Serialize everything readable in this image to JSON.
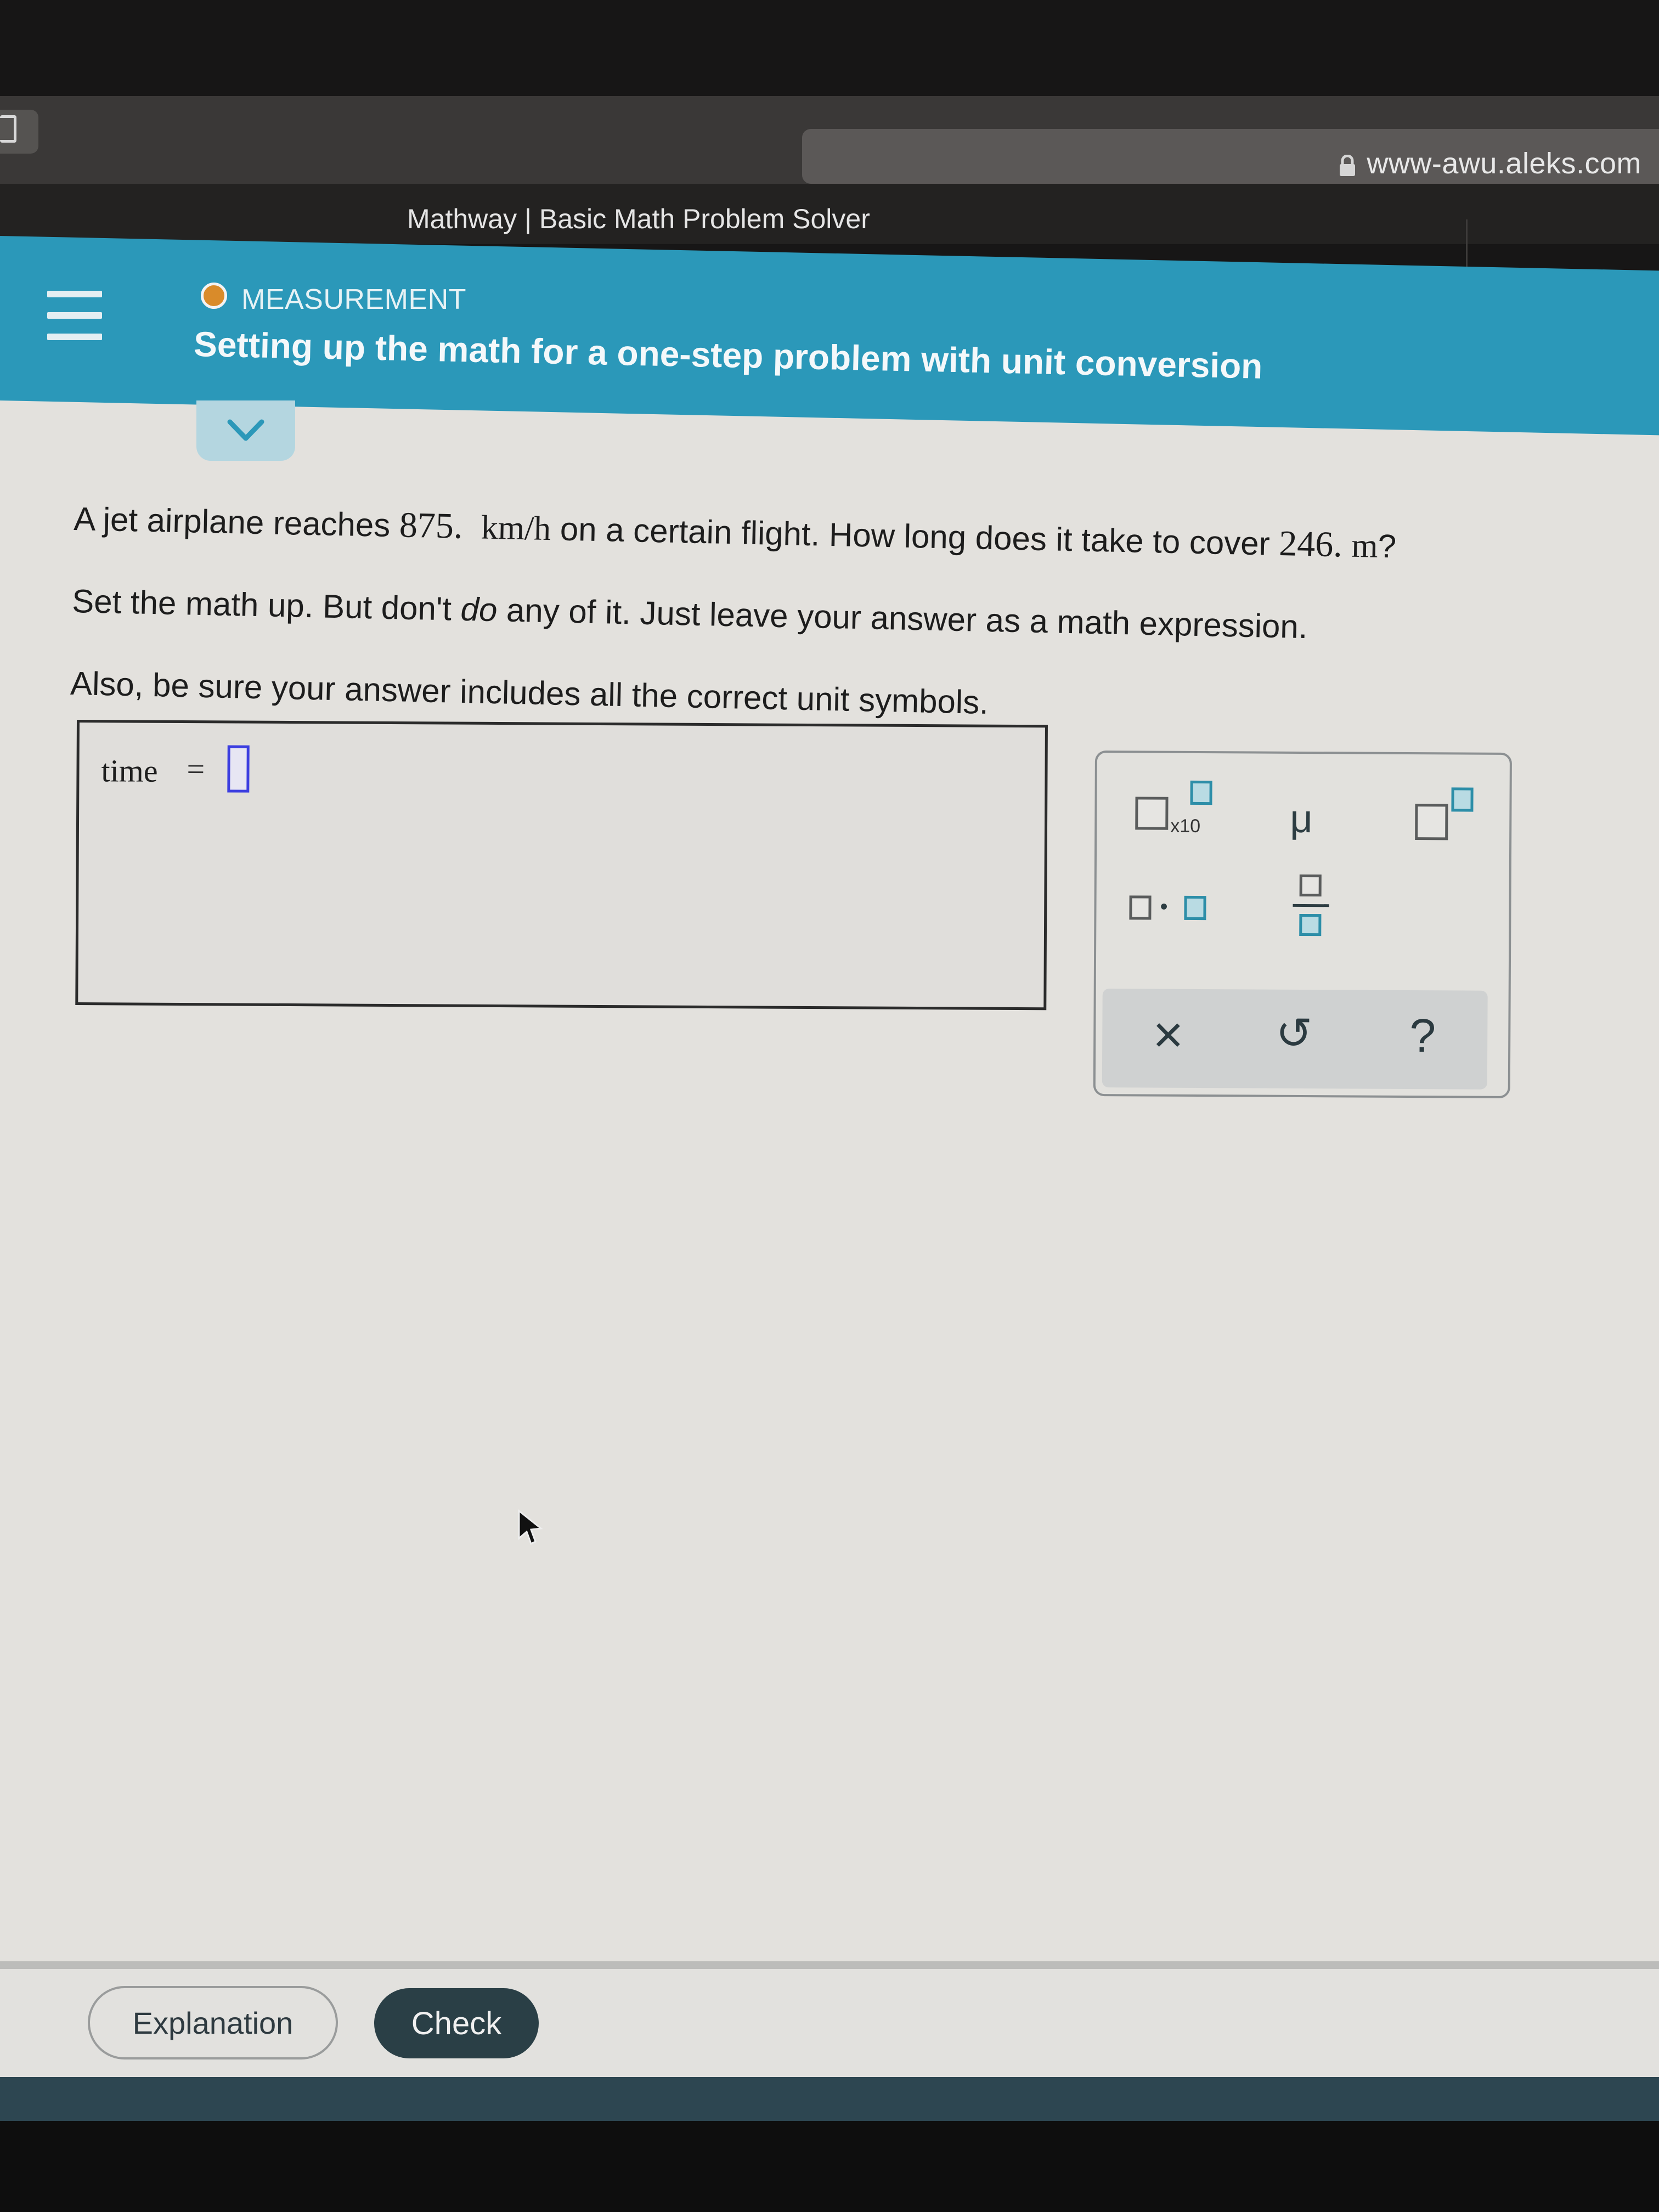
{
  "browser": {
    "url": "www-awu.aleks.com",
    "tab_title": "Mathway | Basic Math Problem Solver",
    "icons": {
      "sidebar": "sidebar-toggle-icon",
      "lock": "lock-icon"
    }
  },
  "header": {
    "topic": "MEASUREMENT",
    "topic_status_color": "#d98b2a",
    "title": "Setting up the math for a one-step problem with unit conversion",
    "accent_color": "#2b98b9",
    "menu_icon": "hamburger-menu-icon",
    "collapse_icon": "chevron-down-icon"
  },
  "question": {
    "line1": {
      "pre": "A jet airplane reaches ",
      "speed_value": "875.",
      "speed_unit": "km/h",
      "mid": " on a certain flight. How long does it take to cover ",
      "distance_value": "246.",
      "distance_unit": "m",
      "post": "?"
    },
    "line2": {
      "pre": "Set the math up. But don't ",
      "emph": "do",
      "post": " any of it. Just leave your answer as a math expression."
    },
    "line3": "Also, be sure your answer includes all the correct unit symbols."
  },
  "answer": {
    "variable": "time",
    "equals": "=",
    "value": ""
  },
  "palette": {
    "buttons": [
      {
        "name": "scientific-notation",
        "label": "x10"
      },
      {
        "name": "mu",
        "label": "μ"
      },
      {
        "name": "superscript",
        "label": ""
      },
      {
        "name": "multiply-dot",
        "label": "•"
      },
      {
        "name": "fraction",
        "label": ""
      }
    ],
    "actions": [
      {
        "name": "clear",
        "label": "×"
      },
      {
        "name": "undo",
        "label": "↺"
      },
      {
        "name": "help",
        "label": "?"
      }
    ]
  },
  "footer": {
    "explanation_label": "Explanation",
    "check_label": "Check",
    "check_color": "#2a3f46"
  }
}
